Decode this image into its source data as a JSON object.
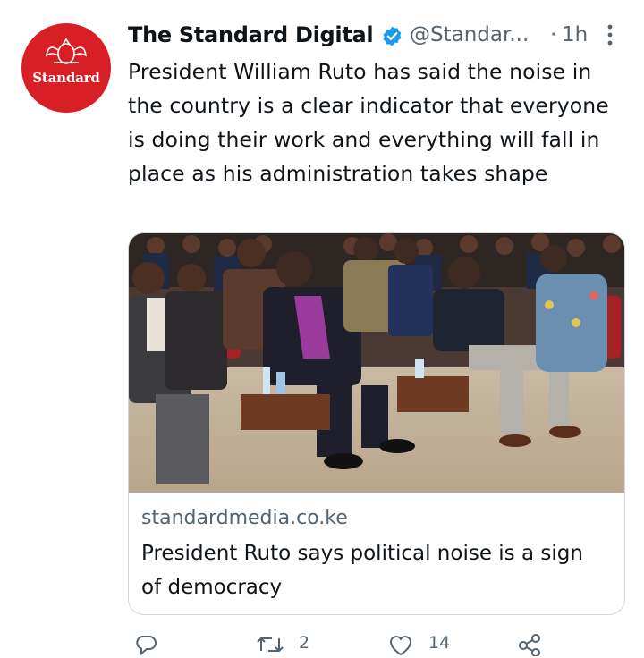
{
  "tweet": {
    "author": {
      "display_name": "The Standard Digital",
      "handle": "@Standar...",
      "avatar_text": "Standard",
      "verified": true
    },
    "separator": "·",
    "time": "1h",
    "text": "President William Ruto has said the noise in the country is a clear indicator that everyone is doing their work and everything will fall in place as his administration takes shape",
    "card": {
      "domain": "standardmedia.co.ke",
      "title": "President Ruto says political noise is a sign of democracy"
    },
    "actions": {
      "reply_count": "",
      "retweet_count": "2",
      "like_count": "14"
    }
  },
  "colors": {
    "brand_red": "#d81f26",
    "verified_blue": "#1d9bf0",
    "secondary_text": "#536471",
    "card_border": "#cfd9de"
  },
  "icons": {
    "verified": "verified-badge-icon",
    "more": "more-vertical-icon",
    "reply": "reply-icon",
    "retweet": "retweet-icon",
    "like": "like-icon",
    "share": "share-icon"
  }
}
